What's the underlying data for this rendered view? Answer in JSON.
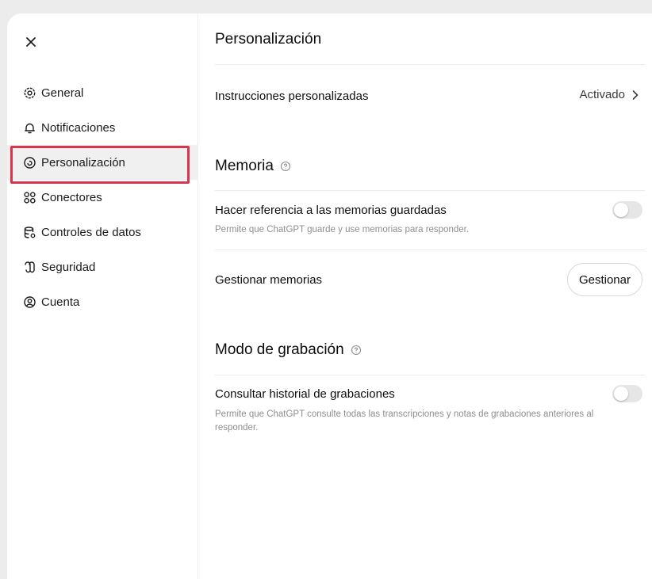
{
  "sidebar": {
    "items": [
      {
        "id": "general",
        "label": "General",
        "icon": "gear-icon",
        "active": false
      },
      {
        "id": "notifications",
        "label": "Notificaciones",
        "icon": "bell-icon",
        "active": false
      },
      {
        "id": "personalization",
        "label": "Personalización",
        "icon": "personalization-icon",
        "active": true
      },
      {
        "id": "connectors",
        "label": "Conectores",
        "icon": "connectors-icon",
        "active": false
      },
      {
        "id": "data-controls",
        "label": "Controles de datos",
        "icon": "database-icon",
        "active": false
      },
      {
        "id": "security",
        "label": "Seguridad",
        "icon": "security-icon",
        "active": false
      },
      {
        "id": "account",
        "label": "Cuenta",
        "icon": "account-icon",
        "active": false
      }
    ]
  },
  "main": {
    "title": "Personalización",
    "custom_instructions": {
      "label": "Instrucciones personalizadas",
      "status": "Activado"
    },
    "memory": {
      "title": "Memoria",
      "reference_saved": {
        "label": "Hacer referencia a las memorias guardadas",
        "description": "Permite que ChatGPT guarde y use memorias para responder.",
        "enabled": false
      },
      "manage": {
        "label": "Gestionar memorias",
        "button": "Gestionar"
      }
    },
    "recording": {
      "title": "Modo de grabación",
      "history": {
        "label": "Consultar historial de grabaciones",
        "description": "Permite que ChatGPT consulte todas las transcripciones y notas de grabaciones anteriores al responder.",
        "enabled": false
      }
    }
  },
  "colors": {
    "highlight_border": "#d9354b",
    "toggle_off": "#e6e6e6",
    "muted_text": "#8e8e8e"
  }
}
